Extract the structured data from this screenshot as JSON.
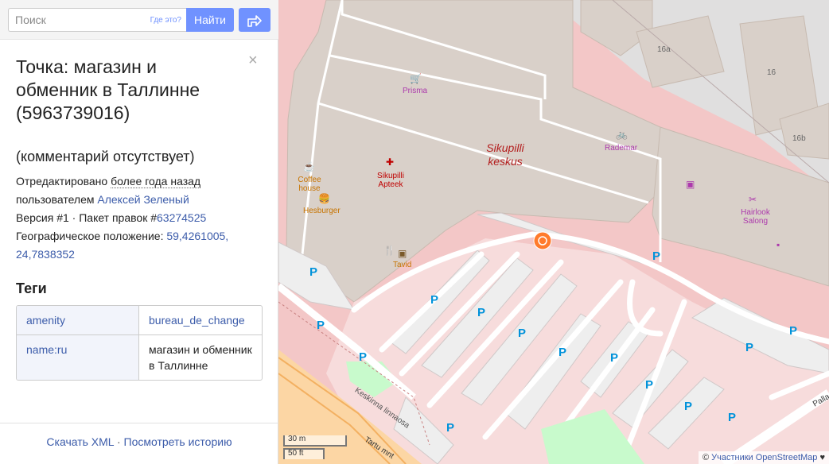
{
  "search": {
    "placeholder": "Поиск",
    "where_label": "Где это?",
    "search_button": "Найти"
  },
  "detail": {
    "title": "Точка: магазин и обменник в Таллинне (5963739016)",
    "close_symbol": "×",
    "comment": "(комментарий отсутствует)",
    "edited_prefix": "Отредактировано ",
    "edited_when": "более года назад",
    "edited_by_prefix": "пользователем ",
    "user": "Алексей Зеленый",
    "version_prefix": "Версия #1 · Пакет правок #",
    "changeset": "63274525",
    "location_label": "Географическое положение: ",
    "location_value": "59,4261005, 24,7838352",
    "tags_heading": "Теги",
    "tags": [
      {
        "key": "amenity",
        "value": "bureau_de_change"
      },
      {
        "key": "name:ru",
        "value": "магазин и обменник в Таллинне"
      }
    ]
  },
  "footer": {
    "download_xml": "Скачать XML",
    "separator": " · ",
    "view_history": "Посмотреть историю"
  },
  "map": {
    "labels": {
      "prisma": "Prisma",
      "rademar": "Rademar",
      "sikupilli_keskus": "Sikupilli keskus",
      "coffee_house": "Coffee house",
      "sikupilli_apteek": "Sikupilli Apteek",
      "hesburger": "Hesburger",
      "hairlook": "Hairlook Salong",
      "tavid": "Tavid",
      "house_16a": "16a",
      "house_16": "16",
      "house_16b": "16b",
      "street_keskinna": "Keskinna linnaosa",
      "street_tartu": "Tartu mnt",
      "street_palla": "Palla",
      "parking": "P"
    },
    "scale_metric": "30 m",
    "scale_imperial": "50 ft",
    "attribution_prefix": "© ",
    "attribution_link": "Участники OpenStreetMap",
    "attribution_suffix": " ♥"
  },
  "colors": {
    "accent": "#7092ff",
    "link": "#3c5caa",
    "building": "#d9d0c9",
    "commercial_area": "#f3c7c7",
    "parking_area": "#eeeeee",
    "poi_shop": "#ac39ac",
    "poi_food": "#c77400",
    "poi_health": "#bf0000",
    "marker": "#ff7b2c",
    "parking_letter": "#0092da",
    "park": "#c8facc"
  }
}
